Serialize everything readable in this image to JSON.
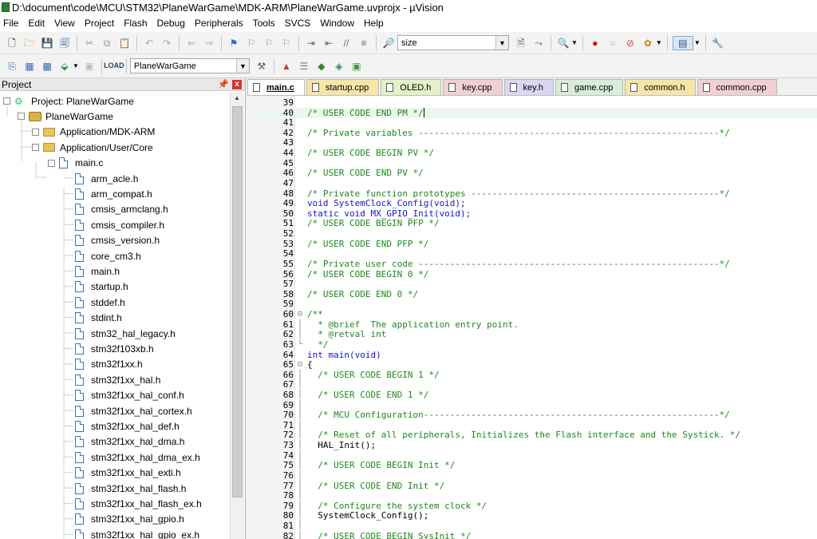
{
  "window": {
    "title": "D:\\document\\code\\MCU\\STM32\\PlaneWarGame\\MDK-ARM\\PlaneWarGame.uvprojx - µVision"
  },
  "menu": [
    "File",
    "Edit",
    "View",
    "Project",
    "Flash",
    "Debug",
    "Peripherals",
    "Tools",
    "SVCS",
    "Window",
    "Help"
  ],
  "toolbar": {
    "find_value": "size",
    "target_value": "PlaneWarGame"
  },
  "project_panel": {
    "title": "Project",
    "pin_icon": "pin-icon",
    "close_label": "x",
    "tree": [
      {
        "label": "Project: PlaneWarGame",
        "icon": "project-icon",
        "expander": "−"
      },
      {
        "label": "PlaneWarGame",
        "icon": "target-icon",
        "expander": "−"
      },
      {
        "label": "Application/MDK-ARM",
        "icon": "folder-icon",
        "expander": "+"
      },
      {
        "label": "Application/User/Core",
        "icon": "folder-open-icon",
        "expander": "−"
      },
      {
        "label": "main.c",
        "icon": "file-icon",
        "expander": "−"
      },
      {
        "label": "arm_acle.h",
        "icon": "file-icon"
      },
      {
        "label": "arm_compat.h",
        "icon": "file-icon"
      },
      {
        "label": "cmsis_armclang.h",
        "icon": "file-icon"
      },
      {
        "label": "cmsis_compiler.h",
        "icon": "file-icon"
      },
      {
        "label": "cmsis_version.h",
        "icon": "file-icon"
      },
      {
        "label": "core_cm3.h",
        "icon": "file-icon"
      },
      {
        "label": "main.h",
        "icon": "file-icon"
      },
      {
        "label": "startup.h",
        "icon": "file-icon"
      },
      {
        "label": "stddef.h",
        "icon": "file-icon"
      },
      {
        "label": "stdint.h",
        "icon": "file-icon"
      },
      {
        "label": "stm32_hal_legacy.h",
        "icon": "file-icon"
      },
      {
        "label": "stm32f103xb.h",
        "icon": "file-icon"
      },
      {
        "label": "stm32f1xx.h",
        "icon": "file-icon"
      },
      {
        "label": "stm32f1xx_hal.h",
        "icon": "file-icon"
      },
      {
        "label": "stm32f1xx_hal_conf.h",
        "icon": "file-icon"
      },
      {
        "label": "stm32f1xx_hal_cortex.h",
        "icon": "file-icon"
      },
      {
        "label": "stm32f1xx_hal_def.h",
        "icon": "file-icon"
      },
      {
        "label": "stm32f1xx_hal_dma.h",
        "icon": "file-icon"
      },
      {
        "label": "stm32f1xx_hal_dma_ex.h",
        "icon": "file-icon"
      },
      {
        "label": "stm32f1xx_hal_exti.h",
        "icon": "file-icon"
      },
      {
        "label": "stm32f1xx_hal_flash.h",
        "icon": "file-icon"
      },
      {
        "label": "stm32f1xx_hal_flash_ex.h",
        "icon": "file-icon"
      },
      {
        "label": "stm32f1xx_hal_gpio.h",
        "icon": "file-icon"
      },
      {
        "label": "stm32f1xx_hal_gpio_ex.h",
        "icon": "file-icon"
      }
    ]
  },
  "editor_tabs": [
    {
      "label": "main.c",
      "active": true,
      "color": "#ffffff"
    },
    {
      "label": "startup.cpp",
      "color": "#f6e6a6"
    },
    {
      "label": "OLED.h",
      "color": "#e4f0c8"
    },
    {
      "label": "key.cpp",
      "color": "#f2cfd4"
    },
    {
      "label": "key.h",
      "color": "#dcd6f2"
    },
    {
      "label": "game.cpp",
      "color": "#d8ecd8"
    },
    {
      "label": "common.h",
      "color": "#f6e6a6"
    },
    {
      "label": "common.cpp",
      "color": "#f2cfd4"
    }
  ],
  "code_lines": [
    {
      "n": "39",
      "t": "",
      "c": "pl"
    },
    {
      "n": "40",
      "t": "/* USER CODE END PM */",
      "c": "cm",
      "caret": true,
      "hl": true
    },
    {
      "n": "41",
      "t": "",
      "c": "pl"
    },
    {
      "n": "42",
      "t": "/* Private variables ---------------------------------------------------------*/",
      "c": "cm"
    },
    {
      "n": "43",
      "t": "",
      "c": "pl"
    },
    {
      "n": "44",
      "t": "/* USER CODE BEGIN PV */",
      "c": "cm"
    },
    {
      "n": "45",
      "t": "",
      "c": "pl"
    },
    {
      "n": "46",
      "t": "/* USER CODE END PV */",
      "c": "cm"
    },
    {
      "n": "47",
      "t": "",
      "c": "pl"
    },
    {
      "n": "48",
      "t": "/* Private function prototypes -----------------------------------------------*/",
      "c": "cm"
    },
    {
      "n": "49",
      "t": "void SystemClock_Config(void);",
      "c": "kw"
    },
    {
      "n": "50",
      "t": "static void MX_GPIO_Init(void);",
      "c": "kw"
    },
    {
      "n": "51",
      "t": "/* USER CODE BEGIN PFP */",
      "c": "cm"
    },
    {
      "n": "52",
      "t": "",
      "c": "pl"
    },
    {
      "n": "53",
      "t": "/* USER CODE END PFP */",
      "c": "cm"
    },
    {
      "n": "54",
      "t": "",
      "c": "pl"
    },
    {
      "n": "55",
      "t": "/* Private user code ---------------------------------------------------------*/",
      "c": "cm"
    },
    {
      "n": "56",
      "t": "/* USER CODE BEGIN 0 */",
      "c": "cm"
    },
    {
      "n": "57",
      "t": "",
      "c": "pl"
    },
    {
      "n": "58",
      "t": "/* USER CODE END 0 */",
      "c": "cm"
    },
    {
      "n": "59",
      "t": "",
      "c": "pl"
    },
    {
      "n": "60",
      "t": "/**",
      "c": "cm",
      "fold": "⊟"
    },
    {
      "n": "61",
      "t": "  * @brief  The application entry point.",
      "c": "cm",
      "fold": "│"
    },
    {
      "n": "62",
      "t": "  * @retval int",
      "c": "cm",
      "fold": "│"
    },
    {
      "n": "63",
      "t": "  */",
      "c": "cm",
      "fold": "└"
    },
    {
      "n": "64",
      "t": "int main(void)",
      "c": "kw"
    },
    {
      "n": "65",
      "t": "{",
      "c": "pl",
      "fold": "⊟"
    },
    {
      "n": "66",
      "t": "  /* USER CODE BEGIN 1 */",
      "c": "cm",
      "fold": "│"
    },
    {
      "n": "67",
      "t": "",
      "c": "pl",
      "fold": "│"
    },
    {
      "n": "68",
      "t": "  /* USER CODE END 1 */",
      "c": "cm",
      "fold": "│"
    },
    {
      "n": "69",
      "t": "",
      "c": "pl",
      "fold": "│"
    },
    {
      "n": "70",
      "t": "  /* MCU Configuration--------------------------------------------------------*/",
      "c": "cm",
      "fold": "│"
    },
    {
      "n": "71",
      "t": "",
      "c": "pl",
      "fold": "│"
    },
    {
      "n": "72",
      "t": "  /* Reset of all peripherals, Initializes the Flash interface and the Systick. */",
      "c": "cm",
      "fold": "│"
    },
    {
      "n": "73",
      "t": "  HAL_Init();",
      "c": "pl",
      "fold": "│"
    },
    {
      "n": "74",
      "t": "",
      "c": "pl",
      "fold": "│"
    },
    {
      "n": "75",
      "t": "  /* USER CODE BEGIN Init */",
      "c": "cm",
      "fold": "│"
    },
    {
      "n": "76",
      "t": "",
      "c": "pl",
      "fold": "│"
    },
    {
      "n": "77",
      "t": "  /* USER CODE END Init */",
      "c": "cm",
      "fold": "│"
    },
    {
      "n": "78",
      "t": "",
      "c": "pl",
      "fold": "│"
    },
    {
      "n": "79",
      "t": "  /* Configure the system clock */",
      "c": "cm",
      "fold": "│"
    },
    {
      "n": "80",
      "t": "  SystemClock_Config();",
      "c": "pl",
      "fold": "│"
    },
    {
      "n": "81",
      "t": "",
      "c": "pl",
      "fold": "│"
    },
    {
      "n": "82",
      "t": "  /* USER CODE BEGIN SysInit */",
      "c": "cm",
      "fold": "│"
    }
  ]
}
